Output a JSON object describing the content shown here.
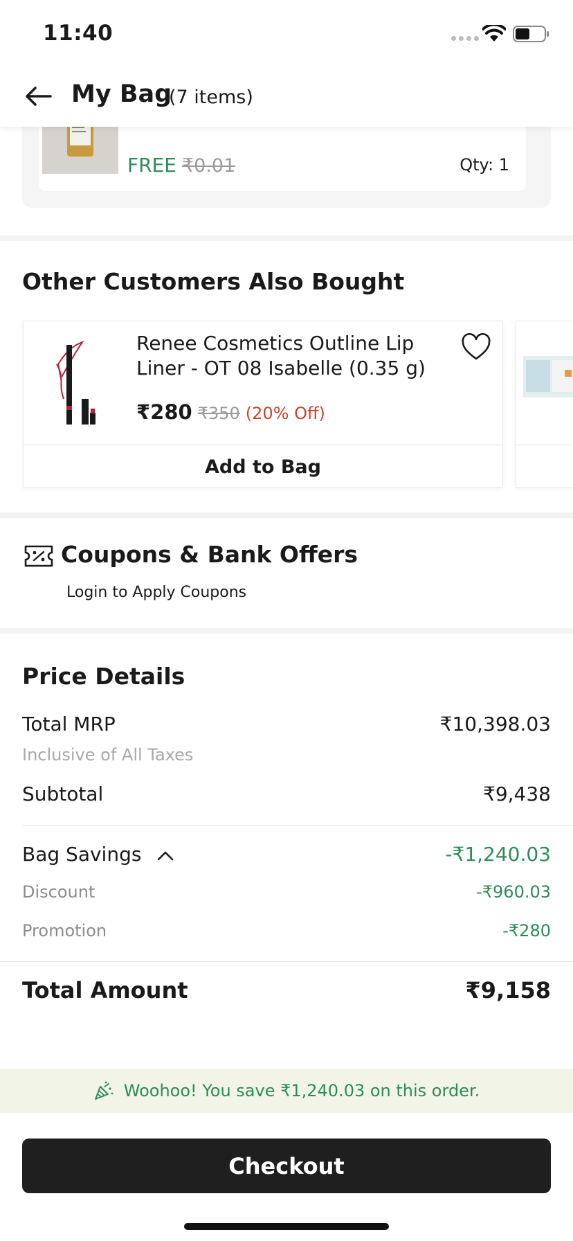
{
  "status_bar": {
    "time": "11:40"
  },
  "header": {
    "title": "My Bag",
    "count": "(7 items)"
  },
  "bag_item": {
    "free_label": "FREE",
    "original_price": "₹0.01",
    "qty": "Qty: 1"
  },
  "recommendations": {
    "title": "Other Customers Also Bought",
    "items": [
      {
        "name": "Renee Cosmetics Outline Lip Liner - OT 08 Isabelle (0.35 g)",
        "price": "₹280",
        "mrp": "₹350",
        "discount": "(20% Off)",
        "button": "Add to Bag"
      }
    ]
  },
  "coupons": {
    "title": "Coupons & Bank Offers",
    "subtitle": "Login to Apply Coupons"
  },
  "price_details": {
    "title": "Price Details",
    "total_mrp_label": "Total MRP",
    "total_mrp_value": "₹10,398.03",
    "taxes_note": "Inclusive of All Taxes",
    "subtotal_label": "Subtotal",
    "subtotal_value": "₹9,438",
    "bag_savings_label": "Bag Savings",
    "bag_savings_value": "-₹1,240.03",
    "discount_label": "Discount",
    "discount_value": "-₹960.03",
    "promotion_label": "Promotion",
    "promotion_value": "-₹280",
    "total_label": "Total Amount",
    "total_value": "₹9,158"
  },
  "savings_banner": {
    "text": "Woohoo! You save ₹1,240.03 on this order."
  },
  "checkout": {
    "label": "Checkout"
  },
  "colors": {
    "accent_green": "#2e8b57",
    "discount_red": "#c8452c",
    "checkout_bg": "#1f1f1f"
  }
}
